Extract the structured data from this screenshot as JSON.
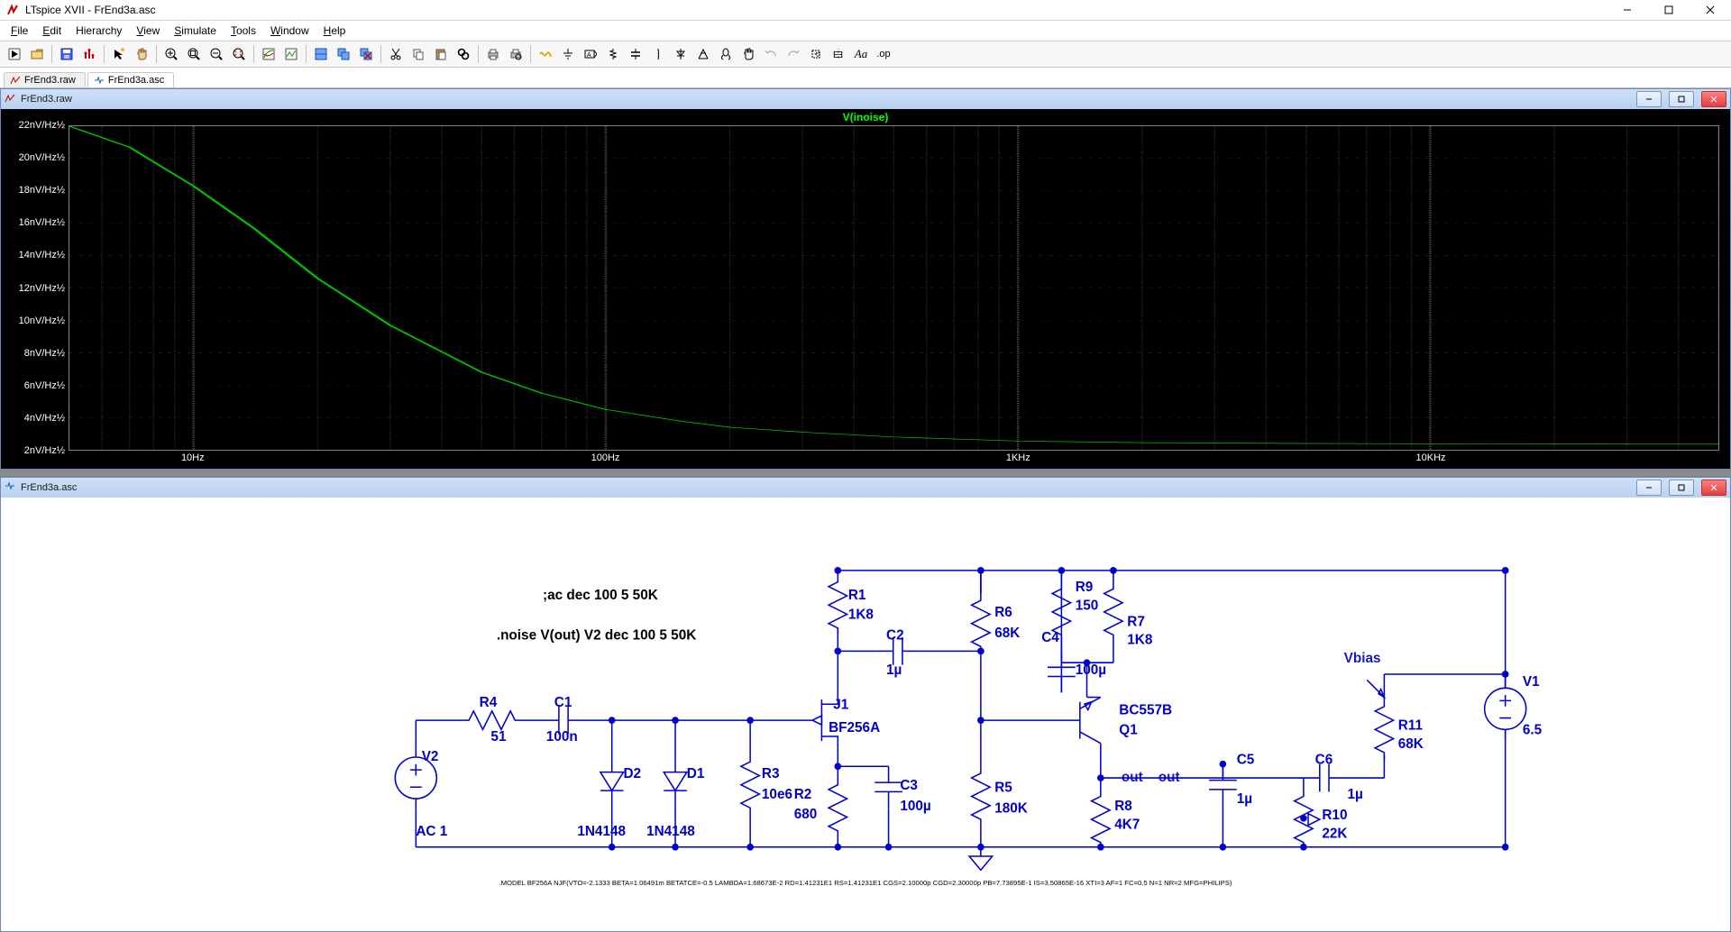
{
  "app": {
    "title": "LTspice XVII - FrEnd3a.asc"
  },
  "menu": {
    "items": [
      "File",
      "Edit",
      "Hierarchy",
      "View",
      "Simulate",
      "Tools",
      "Window",
      "Help"
    ]
  },
  "doctabs": [
    {
      "label": "FrEnd3.raw"
    },
    {
      "label": "FrEnd3a.asc"
    }
  ],
  "win_plot": {
    "title": "FrEnd3.raw"
  },
  "win_schem": {
    "title": "FrEnd3a.asc"
  },
  "plot": {
    "trace_label": "V(inoise)",
    "ylim_nV": [
      2,
      22
    ],
    "yticks": [
      "22nV/Hz½",
      "20nV/Hz½",
      "18nV/Hz½",
      "16nV/Hz½",
      "14nV/Hz½",
      "12nV/Hz½",
      "10nV/Hz½",
      "8nV/Hz½",
      "6nV/Hz½",
      "4nV/Hz½",
      "2nV/Hz½"
    ],
    "ytick_vals": [
      22,
      20,
      18,
      16,
      14,
      12,
      10,
      8,
      6,
      4,
      2
    ],
    "xlim_hz": [
      5,
      50000
    ],
    "xdecade_labels": [
      "10Hz",
      "100Hz",
      "1KHz",
      "10KHz"
    ],
    "xdecade_vals": [
      10,
      100,
      1000,
      10000
    ]
  },
  "chart_data": {
    "type": "line",
    "title": "V(inoise)",
    "xlabel": "Hz",
    "xscale": "log",
    "xlim": [
      5,
      50000
    ],
    "ylabel": "nV/Hz½",
    "ylim": [
      2,
      22
    ],
    "series": [
      {
        "name": "V(inoise)",
        "color": "#00c000",
        "x": [
          5,
          7,
          10,
          14,
          20,
          30,
          50,
          70,
          100,
          150,
          200,
          300,
          500,
          1000,
          2000,
          5000,
          10000,
          20000,
          50000
        ],
        "y": [
          22,
          20.7,
          18.3,
          15.7,
          12.6,
          9.7,
          6.8,
          5.5,
          4.5,
          3.8,
          3.4,
          3.1,
          2.8,
          2.55,
          2.45,
          2.4,
          2.38,
          2.37,
          2.36
        ]
      }
    ]
  },
  "schematic": {
    "directives": {
      "d1": ";ac dec 100 5 50K",
      "d2": ".noise V(out) V2 dec 100 5 50K"
    },
    "modelline": ".MODEL BF256A NJF(VTO=-2.1333 BETA=1.06491m BETATCE=-0.5 LAMBDA=1.68673E-2 RD=1.41231E1 RS=1.41231E1 CGS=2.10000p CGD=2.30000p PB=7.73895E-1 IS=3.50865E-16 XTI=3 AF=1 FC=0.5 N=1 NR=2 MFG=PHILIPS)",
    "parts": {
      "V2": {
        "ref": "V2",
        "val": "AC 1"
      },
      "R4": {
        "ref": "R4",
        "val": "51"
      },
      "C1": {
        "ref": "C1",
        "val": "100n"
      },
      "D2": {
        "ref": "D2",
        "val": "1N4148"
      },
      "D1": {
        "ref": "D1",
        "val": "1N4148"
      },
      "R3": {
        "ref": "R3",
        "val": "10e6"
      },
      "J1": {
        "ref": "J1",
        "val": "BF256A"
      },
      "R1": {
        "ref": "R1",
        "val": "1K8"
      },
      "R2": {
        "ref": "R2",
        "val": "680"
      },
      "C3": {
        "ref": "C3",
        "val": "100µ"
      },
      "C2": {
        "ref": "C2",
        "val": "1µ"
      },
      "R6": {
        "ref": "R6",
        "val": "68K"
      },
      "R5": {
        "ref": "R5",
        "val": "180K"
      },
      "R9": {
        "ref": "R9",
        "val": "150"
      },
      "C4": {
        "ref": "C4",
        "val": "100µ"
      },
      "R7": {
        "ref": "R7",
        "val": "1K8"
      },
      "Q1": {
        "ref": "Q1",
        "val": "BC557B"
      },
      "R8": {
        "ref": "R8",
        "val": "4K7"
      },
      "C5": {
        "ref": "C5",
        "val": "1µ"
      },
      "C6": {
        "ref": "C6",
        "val": "1µ"
      },
      "R10": {
        "ref": "R10",
        "val": "22K"
      },
      "R11": {
        "ref": "R11",
        "val": "68K"
      },
      "V1": {
        "ref": "V1",
        "val": "6.5"
      }
    },
    "nets": {
      "out": "out",
      "out2": "out",
      "vbias": "Vbias"
    }
  }
}
